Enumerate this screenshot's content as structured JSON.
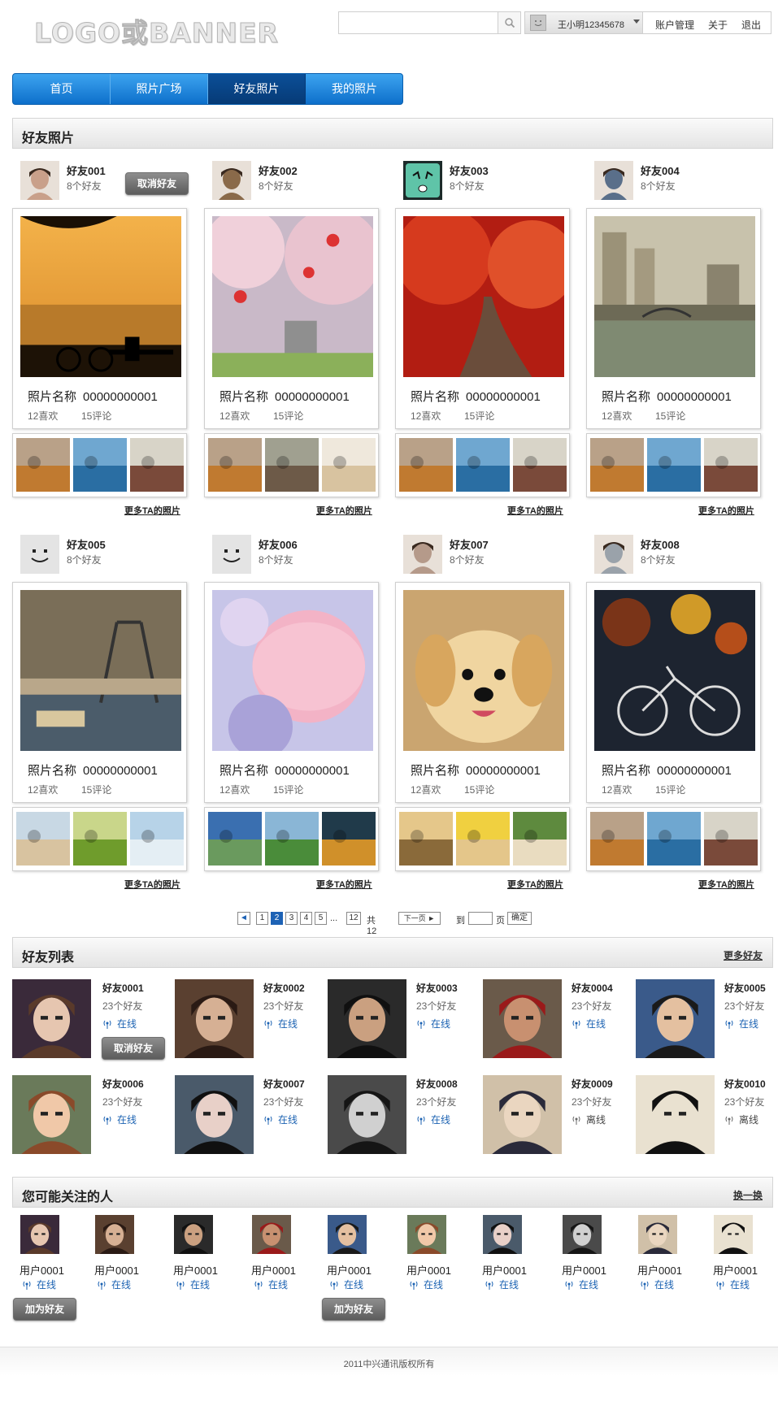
{
  "header": {
    "logo": "LOGO或BANNER",
    "search_placeholder": "",
    "user_name": "王小明12345678",
    "links": [
      "账户管理",
      "关于",
      "退出"
    ]
  },
  "nav": {
    "tabs": [
      "首页",
      "照片广场",
      "好友照片",
      "我的照片"
    ],
    "active_index": 2
  },
  "friend_photos": {
    "title": "好友照片",
    "friends": [
      {
        "name": "好友001",
        "count": "8个好友",
        "photo_title": "照片名称",
        "photo_id": "00000000001",
        "likes": "12喜欢",
        "comments": "15评论",
        "more": "更多TA的照片",
        "action": "取消好友"
      },
      {
        "name": "好友002",
        "count": "8个好友",
        "photo_title": "照片名称",
        "photo_id": "00000000001",
        "likes": "12喜欢",
        "comments": "15评论",
        "more": "更多TA的照片"
      },
      {
        "name": "好友003",
        "count": "8个好友",
        "photo_title": "照片名称",
        "photo_id": "00000000001",
        "likes": "12喜欢",
        "comments": "15评论",
        "more": "更多TA的照片"
      },
      {
        "name": "好友004",
        "count": "8个好友",
        "photo_title": "照片名称",
        "photo_id": "00000000001",
        "likes": "12喜欢",
        "comments": "15评论",
        "more": "更多TA的照片"
      },
      {
        "name": "好友005",
        "count": "8个好友",
        "photo_title": "照片名称",
        "photo_id": "00000000001",
        "likes": "12喜欢",
        "comments": "15评论",
        "more": "更多TA的照片"
      },
      {
        "name": "好友006",
        "count": "8个好友",
        "photo_title": "照片名称",
        "photo_id": "00000000001",
        "likes": "12喜欢",
        "comments": "15评论",
        "more": "更多TA的照片"
      },
      {
        "name": "好友007",
        "count": "8个好友",
        "photo_title": "照片名称",
        "photo_id": "00000000001",
        "likes": "12喜欢",
        "comments": "15评论",
        "more": "更多TA的照片"
      },
      {
        "name": "好友008",
        "count": "8个好友",
        "photo_title": "照片名称",
        "photo_id": "00000000001",
        "likes": "12喜欢",
        "comments": "15评论",
        "more": "更多TA的照片"
      }
    ]
  },
  "pagination": {
    "prev": "◄",
    "pages": [
      "1",
      "2",
      "3",
      "4",
      "5"
    ],
    "current": "2",
    "ellipsis": "...",
    "last": "12",
    "total": "共12页",
    "next": "下一页 ►",
    "goto_label": "到",
    "goto_value": "",
    "page_unit": "页",
    "confirm": "确定"
  },
  "friend_list": {
    "title": "好友列表",
    "more": "更多好友",
    "action": "取消好友",
    "friends": [
      {
        "name": "好友0001",
        "count": "23个好友",
        "status": "在线"
      },
      {
        "name": "好友0002",
        "count": "23个好友",
        "status": "在线"
      },
      {
        "name": "好友0003",
        "count": "23个好友",
        "status": "在线"
      },
      {
        "name": "好友0004",
        "count": "23个好友",
        "status": "在线"
      },
      {
        "name": "好友0005",
        "count": "23个好友",
        "status": "在线"
      },
      {
        "name": "好友0006",
        "count": "23个好友",
        "status": "在线"
      },
      {
        "name": "好友0007",
        "count": "23个好友",
        "status": "在线"
      },
      {
        "name": "好友0008",
        "count": "23个好友",
        "status": "在线"
      },
      {
        "name": "好友0009",
        "count": "23个好友",
        "status": "离线"
      },
      {
        "name": "好友0010",
        "count": "23个好友",
        "status": "离线"
      }
    ]
  },
  "recommend": {
    "title": "您可能关注的人",
    "refresh": "换一换",
    "add_label": "加为好友",
    "users": [
      {
        "name": "用户0001",
        "status": "在线"
      },
      {
        "name": "用户0001",
        "status": "在线"
      },
      {
        "name": "用户0001",
        "status": "在线"
      },
      {
        "name": "用户0001",
        "status": "在线"
      },
      {
        "name": "用户0001",
        "status": "在线"
      },
      {
        "name": "用户0001",
        "status": "在线"
      },
      {
        "name": "用户0001",
        "status": "在线"
      },
      {
        "name": "用户0001",
        "status": "在线"
      },
      {
        "name": "用户0001",
        "status": "在线"
      },
      {
        "name": "用户0001",
        "status": "在线"
      }
    ]
  },
  "footer": {
    "copyright": "2011中兴通讯版权所有"
  },
  "colors": {
    "nav_blue": "#0d6fcb",
    "nav_active": "#063a76",
    "online_blue": "#1b62b2"
  }
}
